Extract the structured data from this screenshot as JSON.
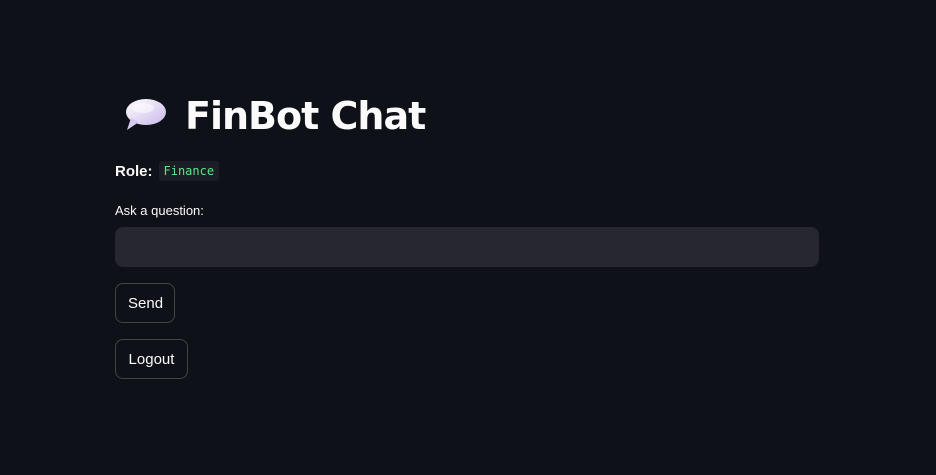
{
  "header": {
    "icon": "speech-bubble-icon",
    "title": "FinBot Chat"
  },
  "role": {
    "label": "Role:",
    "value": "Finance"
  },
  "question": {
    "label": "Ask a question:",
    "value": "",
    "placeholder": ""
  },
  "buttons": {
    "send_label": "Send",
    "logout_label": "Logout"
  },
  "colors": {
    "background": "#0e1117",
    "input_background": "#262730",
    "role_badge_text": "#5ce488",
    "text": "#fafafa"
  }
}
